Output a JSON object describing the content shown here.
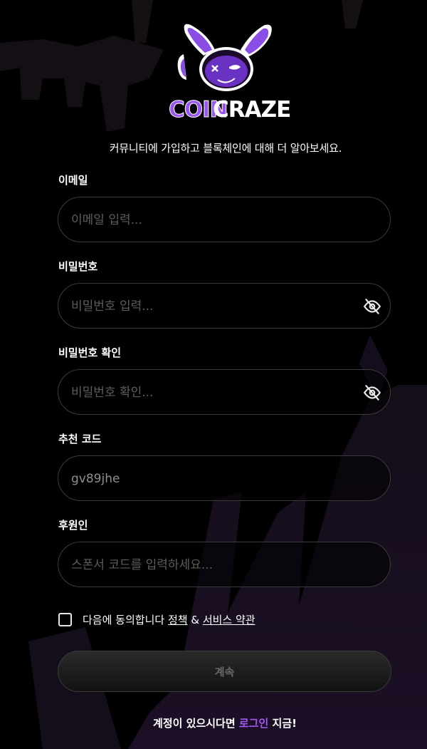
{
  "brand": {
    "name_part1": "COIN",
    "name_part2": "CRAZE"
  },
  "tagline": "커뮤니티에 가입하고 블록체인에 대해 더 알아보세요.",
  "form": {
    "email": {
      "label": "이메일",
      "placeholder": "이메일 입력...",
      "value": ""
    },
    "password": {
      "label": "비밀번호",
      "placeholder": "비밀번호 입력...",
      "value": ""
    },
    "password_confirm": {
      "label": "비밀번호 확인",
      "placeholder": "비밀번호 확인...",
      "value": ""
    },
    "referral": {
      "label": "추천 코드",
      "placeholder": "",
      "value": "gv89jhe"
    },
    "sponsor": {
      "label": "후원인",
      "placeholder": "스폰서 코드를 입력하세요...",
      "value": ""
    }
  },
  "agreement": {
    "prefix": "다음에 동의합니다",
    "policy_link": "정책",
    "separator": "&",
    "terms_link": "서비스 약관",
    "checked": false
  },
  "continue_label": "계속",
  "login_prompt": {
    "before": "계정이 있으시다면",
    "link": "로그인",
    "after": "지금!"
  },
  "colors": {
    "accent": "#a457f5",
    "background": "#000000"
  }
}
